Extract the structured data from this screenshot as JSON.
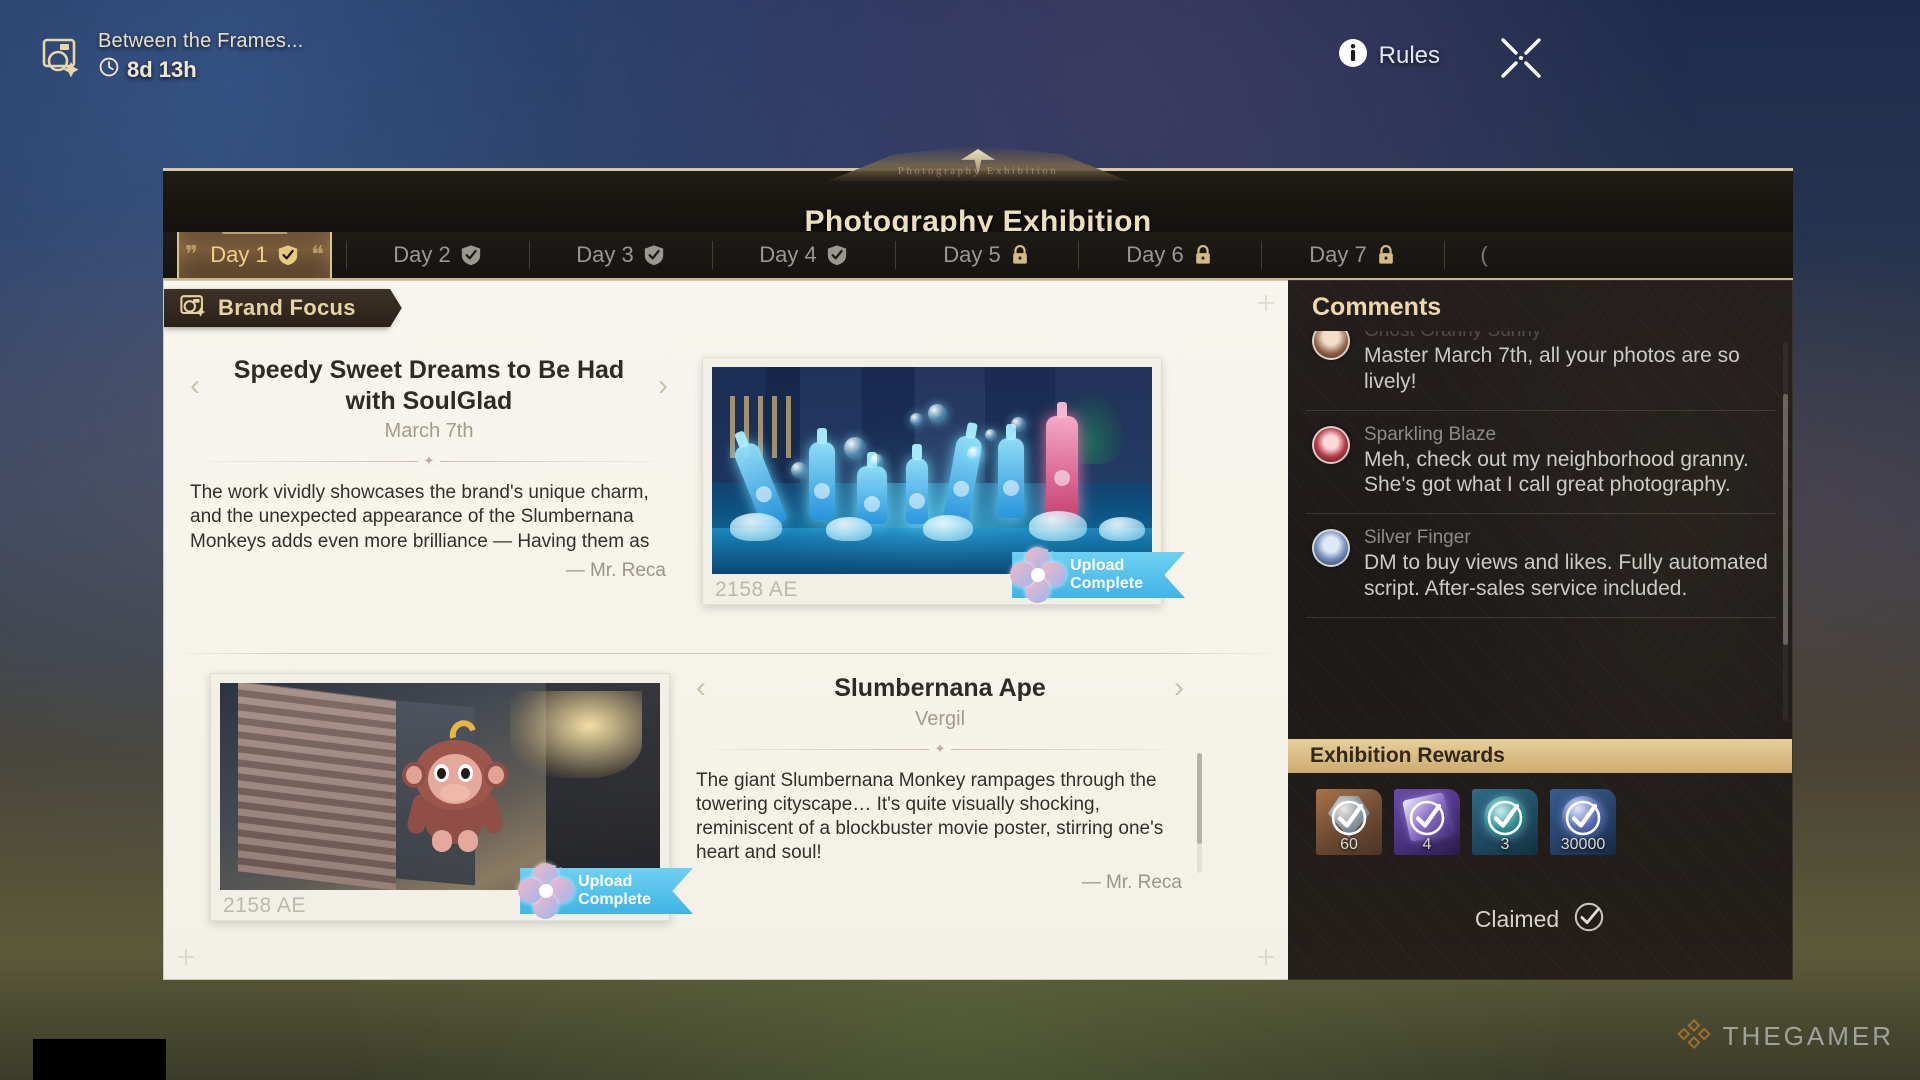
{
  "event": {
    "icon": "photo-stack-icon",
    "title": "Between the Frames...",
    "timer_icon": "clock-icon",
    "timer": "8d 13h"
  },
  "topbar": {
    "rules_icon": "info-icon",
    "rules_label": "Rules",
    "close_icon": "close-icon"
  },
  "panel": {
    "subtitle_ornament": "Photography Exhibition",
    "title": "Photography Exhibition"
  },
  "tabs": [
    {
      "label": "Day 1",
      "status": "completed",
      "active": true
    },
    {
      "label": "Day 2",
      "status": "completed",
      "active": false
    },
    {
      "label": "Day 3",
      "status": "completed",
      "active": false
    },
    {
      "label": "Day 4",
      "status": "completed",
      "active": false
    },
    {
      "label": "Day 5",
      "status": "locked",
      "active": false
    },
    {
      "label": "Day 6",
      "status": "locked",
      "active": false
    },
    {
      "label": "Day 7",
      "status": "locked",
      "active": false
    }
  ],
  "content": {
    "section_badge": "Brand Focus",
    "section_badge_icon": "camera-icon",
    "articles": [
      {
        "title": "Speedy Sweet Dreams to Be Had with SoulGlad",
        "author": "March 7th",
        "body": "The work vividly showcases the brand's unique charm, and the unexpected appearance of the Slumbernana Monkeys adds even more brilliance — Having them as",
        "signature": "— Mr. Reca",
        "prev_arrow": "‹",
        "next_arrow": "›",
        "photo": {
          "year_label": "2158 AE",
          "upload_status_line1": "Upload",
          "upload_status_line2": "Complete",
          "upload_icon": "flower-badge-icon"
        }
      },
      {
        "title": "Slumbernana Ape",
        "author": "Vergil",
        "body": "The giant Slumbernana Monkey rampages through the towering cityscape… It's quite visually shocking, reminiscent of a blockbuster movie poster, stirring one's heart and soul!",
        "signature": "— Mr. Reca",
        "prev_arrow": "‹",
        "next_arrow": "›",
        "photo": {
          "year_label": "2158 AE",
          "upload_status_line1": "Upload",
          "upload_status_line2": "Complete",
          "upload_icon": "flower-badge-icon"
        }
      }
    ]
  },
  "sidebar": {
    "comments_title": "Comments",
    "comments": [
      {
        "name": "Ghost Granny Sunny",
        "name_clipped": true,
        "text": "Master March 7th, all your photos are so lively!"
      },
      {
        "name": "Sparkling Blaze",
        "name_clipped": false,
        "text": "Meh, check out my neighborhood granny. She's got what I call great photography."
      },
      {
        "name": "Silver Finger",
        "name_clipped": false,
        "text": "DM to buy views and likes. Fully automated script. After-sales service included."
      }
    ],
    "rewards_title": "Exhibition Rewards",
    "rewards": [
      {
        "qty": "60",
        "claimed": true
      },
      {
        "qty": "4",
        "claimed": true
      },
      {
        "qty": "3",
        "claimed": true
      },
      {
        "qty": "30000",
        "claimed": true
      }
    ],
    "claimed_label": "Claimed",
    "claimed_icon": "check-circle-icon"
  },
  "watermark": {
    "text": "THEGAMER",
    "logo": "thegamer-logo"
  },
  "colors": {
    "gold": "#e7d2a4",
    "panel_dark": "#1d1917",
    "paper": "#f7f5ed",
    "upload_blue": "#3fb4e6",
    "rewards_bar": "#d9bb82"
  }
}
